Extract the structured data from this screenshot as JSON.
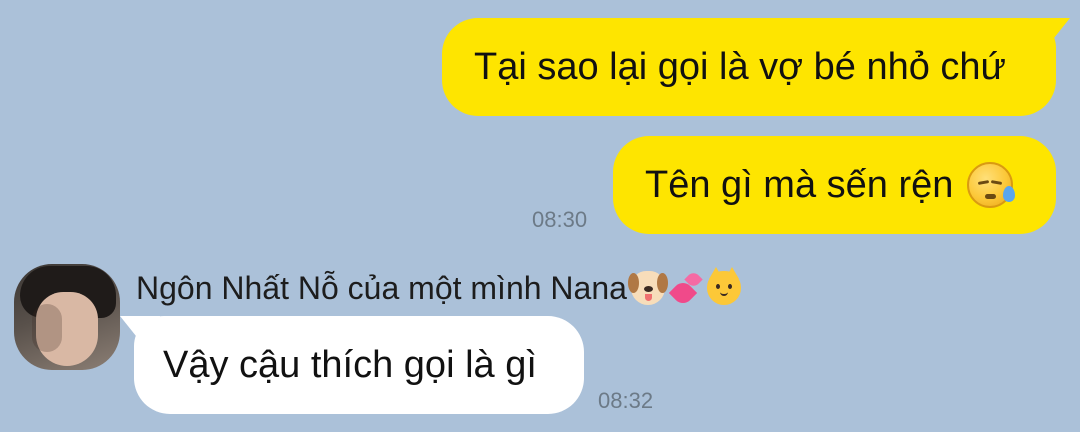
{
  "messages": {
    "outgoing_1": {
      "text": "Tại sao lại gọi là vợ bé nhỏ chứ"
    },
    "outgoing_2": {
      "text": "Tên gì mà sến rện",
      "emoji": "sleepy-face-icon",
      "time": "08:30"
    },
    "incoming_1": {
      "sender": "Ngôn Nhất Nỗ của một mình Nana",
      "sender_emojis": [
        "dog-face-icon",
        "two-hearts-icon",
        "cat-face-icon"
      ],
      "text": "Vậy cậu thích gọi là gì",
      "time": "08:32"
    }
  },
  "colors": {
    "background": "#abc1d9",
    "outgoing_bubble": "#fee500",
    "incoming_bubble": "#ffffff",
    "timestamp": "#6c7a87"
  }
}
